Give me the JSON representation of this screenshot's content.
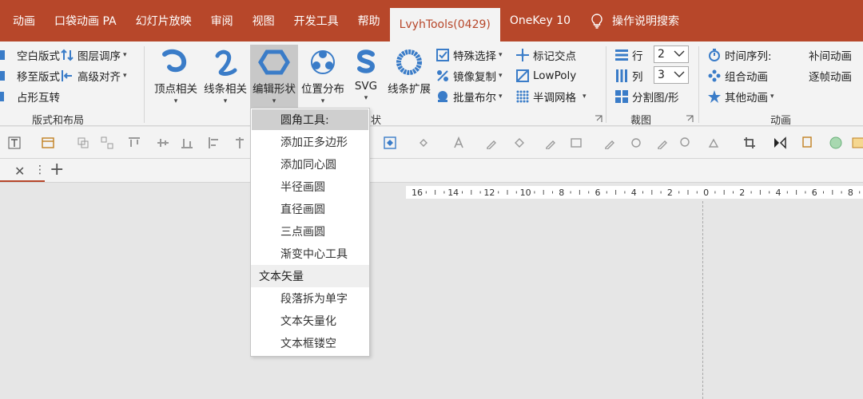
{
  "tabs": [
    {
      "label": "动画"
    },
    {
      "label": "口袋动画 PA"
    },
    {
      "label": "幻灯片放映"
    },
    {
      "label": "审阅"
    },
    {
      "label": "视图"
    },
    {
      "label": "开发工具"
    },
    {
      "label": "帮助"
    },
    {
      "label": "LvyhTools(0429)",
      "active": true
    },
    {
      "label": "OneKey 10"
    },
    {
      "label": "操作说明搜索"
    }
  ],
  "ribbon": {
    "layout_group": {
      "label": "版式和布局",
      "items": [
        "空白版式",
        "图层调序",
        "移至版式",
        "高级对齐",
        "占形互转"
      ]
    },
    "shape_group": {
      "label_tail": "状",
      "big_buttons": [
        "顶点相关",
        "线条相关",
        "编辑形状",
        "位置分布",
        "SVG",
        "线条扩展"
      ],
      "small_buttons": [
        "特殊选择",
        "标记交点",
        "镜像复制",
        "LowPoly",
        "批量布尔",
        "半调网格"
      ]
    },
    "crop_group": {
      "label": "裁图",
      "row_label": "行",
      "row_value": "2",
      "col_label": "列",
      "col_value": "3",
      "split_label": "分割图/形"
    },
    "anim_group": {
      "label": "动画",
      "items": [
        "时间序列:",
        "补间动画",
        "组合动画",
        "逐帧动画",
        "其他动画"
      ]
    }
  },
  "ruler": {
    "labels": [
      "16",
      "14",
      "12",
      "10",
      "8",
      "6",
      "4",
      "2",
      "0",
      "2",
      "4",
      "6",
      "8"
    ]
  },
  "dropdown": {
    "sections": [
      {
        "header": "圆角工具:",
        "items": [
          "添加正多边形",
          "添加同心圆",
          "半径画圆",
          "直径画圆",
          "三点画圆",
          "渐变中心工具"
        ]
      },
      {
        "header": "文本矢量",
        "items": [
          "段落拆为单字",
          "文本矢量化",
          "文本框镂空"
        ]
      }
    ]
  },
  "colors": {
    "accent": "#b7472a",
    "icon_blue": "#3a7cc8",
    "ribbon_bg": "#f3f3f3"
  }
}
